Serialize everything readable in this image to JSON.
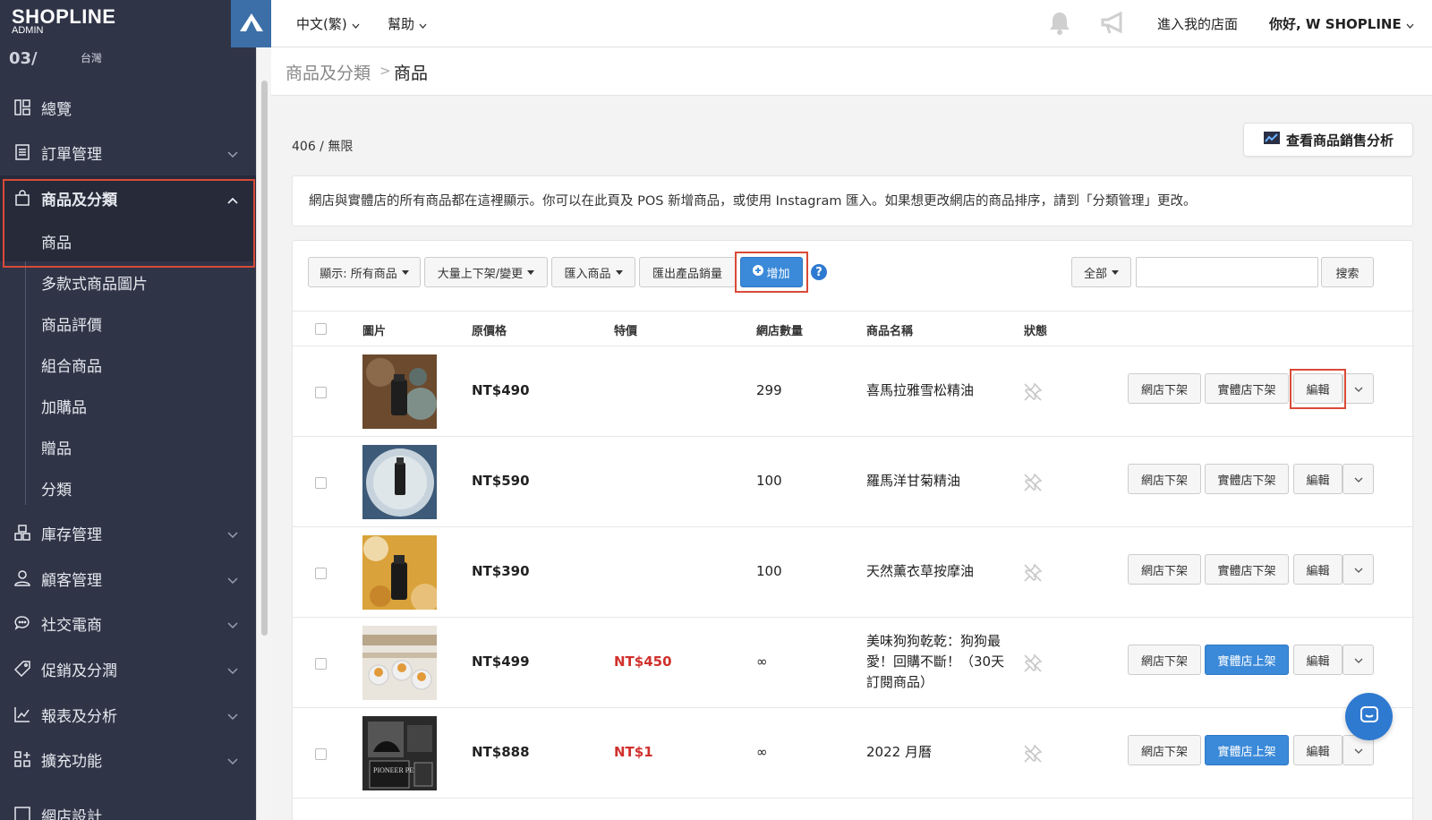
{
  "app": {
    "logo": "SHOPLINE",
    "logo_sub": "ADMIN",
    "store_partial": "03/",
    "store_region": "台灣"
  },
  "topbar": {
    "language": "中文(繁)",
    "help": "幫助",
    "enter_store": "進入我的店面",
    "greeting": "你好, W SHOPLINE"
  },
  "sidebar": {
    "items": [
      {
        "label": "總覽",
        "icon": "dashboard-icon"
      },
      {
        "label": "訂單管理",
        "icon": "order-icon"
      },
      {
        "label": "商品及分類",
        "icon": "bag-icon"
      },
      {
        "label": "庫存管理",
        "icon": "inventory-icon"
      },
      {
        "label": "顧客管理",
        "icon": "user-icon"
      },
      {
        "label": "社交電商",
        "icon": "chat-icon"
      },
      {
        "label": "促銷及分潤",
        "icon": "tag-icon"
      },
      {
        "label": "報表及分析",
        "icon": "report-icon"
      },
      {
        "label": "擴充功能",
        "icon": "apps-icon"
      },
      {
        "label": "網店設計",
        "icon": "design-icon"
      }
    ],
    "sub_items": [
      "商品",
      "多款式商品圖片",
      "商品評價",
      "組合商品",
      "加購品",
      "贈品",
      "分類"
    ]
  },
  "breadcrumb": {
    "parent": "商品及分類",
    "separator": ">",
    "current": "商品"
  },
  "summary": {
    "count": "406 / 無限",
    "analysis_button": "查看商品銷售分析",
    "info_text": "網店與實體店的所有商品都在這裡顯示。你可以在此頁及 POS 新增商品，或使用 Instagram 匯入。如果想更改網店的商品排序，請到「分類管理」更改。"
  },
  "toolbar": {
    "display_filter": "顯示: 所有商品",
    "bulk": "大量上下架/變更",
    "import": "匯入商品",
    "export": "匯出產品銷量",
    "add": "增加",
    "scope": "全部",
    "search": "搜索"
  },
  "table": {
    "headers": [
      "圖片",
      "原價格",
      "特價",
      "網店數量",
      "商品名稱",
      "狀態"
    ],
    "rows": [
      {
        "price": "NT$490",
        "special": "",
        "qty": "299",
        "name": "喜馬拉雅雪松精油",
        "btn1": "網店下架",
        "btn2": "實體店下架",
        "btn2_active": false,
        "edit": "編輯"
      },
      {
        "price": "NT$590",
        "special": "",
        "qty": "100",
        "name": "羅馬洋甘菊精油",
        "btn1": "網店下架",
        "btn2": "實體店下架",
        "btn2_active": false,
        "edit": "編輯"
      },
      {
        "price": "NT$390",
        "special": "",
        "qty": "100",
        "name": "天然薰衣草按摩油",
        "btn1": "網店下架",
        "btn2": "實體店下架",
        "btn2_active": false,
        "edit": "編輯"
      },
      {
        "price": "NT$499",
        "special": "NT$450",
        "qty": "∞",
        "name": "美味狗狗乾乾：狗狗最愛！回購不斷！（30天訂閱商品）",
        "btn1": "網店下架",
        "btn2": "實體店上架",
        "btn2_active": true,
        "edit": "編輯"
      },
      {
        "price": "NT$888",
        "special": "NT$1",
        "qty": "∞",
        "name": "2022 月曆",
        "btn1": "網店下架",
        "btn2": "實體店上架",
        "btn2_active": true,
        "edit": "編輯"
      }
    ]
  },
  "colors": {
    "sidebar_bg": "#2f3447",
    "accent_blue": "#3b8ad9",
    "highlight_red": "#d94a38",
    "special_price_red": "#d0312d"
  }
}
